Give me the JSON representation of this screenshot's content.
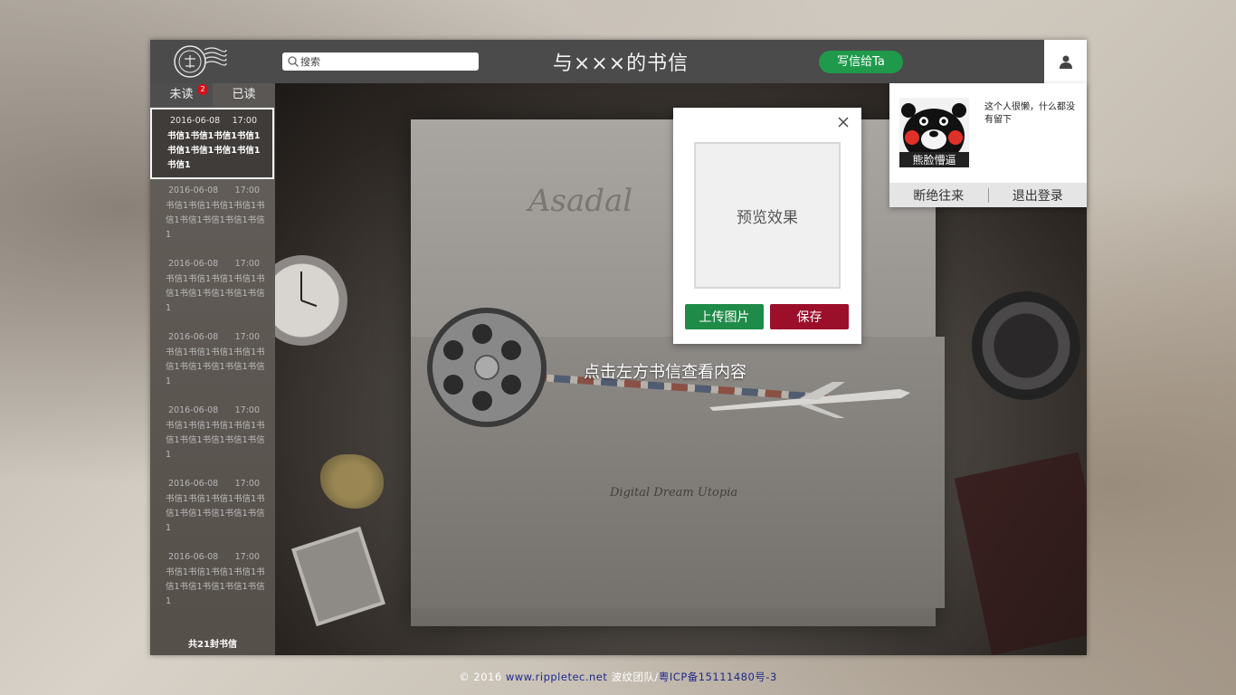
{
  "header": {
    "search_placeholder": "搜索",
    "title": "与×××的书信",
    "write_button": "写信给Ta"
  },
  "sidebar": {
    "tabs": [
      {
        "label": "未读",
        "badge": "2"
      },
      {
        "label": "已读"
      }
    ],
    "letters": [
      {
        "date": "2016-06-08",
        "time": "17:00",
        "preview": "书信1书信1书信1书信1书信1书信1书信1书信1书信1"
      },
      {
        "date": "2016-06-08",
        "time": "17:00",
        "preview": "书信1书信1书信1书信1书信1书信1书信1书信1书信1"
      },
      {
        "date": "2016-06-08",
        "time": "17:00",
        "preview": "书信1书信1书信1书信1书信1书信1书信1书信1书信1"
      },
      {
        "date": "2016-06-08",
        "time": "17:00",
        "preview": "书信1书信1书信1书信1书信1书信1书信1书信1书信1"
      },
      {
        "date": "2016-06-08",
        "time": "17:00",
        "preview": "书信1书信1书信1书信1书信1书信1书信1书信1书信1"
      },
      {
        "date": "2016-06-08",
        "time": "17:00",
        "preview": "书信1书信1书信1书信1书信1书信1书信1书信1书信1"
      },
      {
        "date": "2016-06-08",
        "time": "17:00",
        "preview": "书信1书信1书信1书信1书信1书信1书信1书信1书信1"
      }
    ],
    "total": "共21封书信"
  },
  "main": {
    "hint": "点击左方书信查看内容",
    "script_text": "Asadal",
    "dream_text": "Digital Dream Utopia"
  },
  "dialog": {
    "preview_label": "预览效果",
    "upload_button": "上传图片",
    "save_button": "保存"
  },
  "profile": {
    "avatar_caption": "熊脸懵逼",
    "bio": "这个人很懒，什么都没有留下",
    "actions": [
      "断绝往来",
      "退出登录"
    ]
  },
  "footer": {
    "copyright": "© 2016",
    "site": "www.rippletec.net",
    "team": "波纹团队/",
    "icp": "粤ICP备15111480号-3"
  },
  "colors": {
    "write_button": "#1f9a4b",
    "upload_button": "#1f8b48",
    "save_button": "#9b0f2b",
    "badge": "#d0121b",
    "topbar": "#4b4b4b"
  }
}
